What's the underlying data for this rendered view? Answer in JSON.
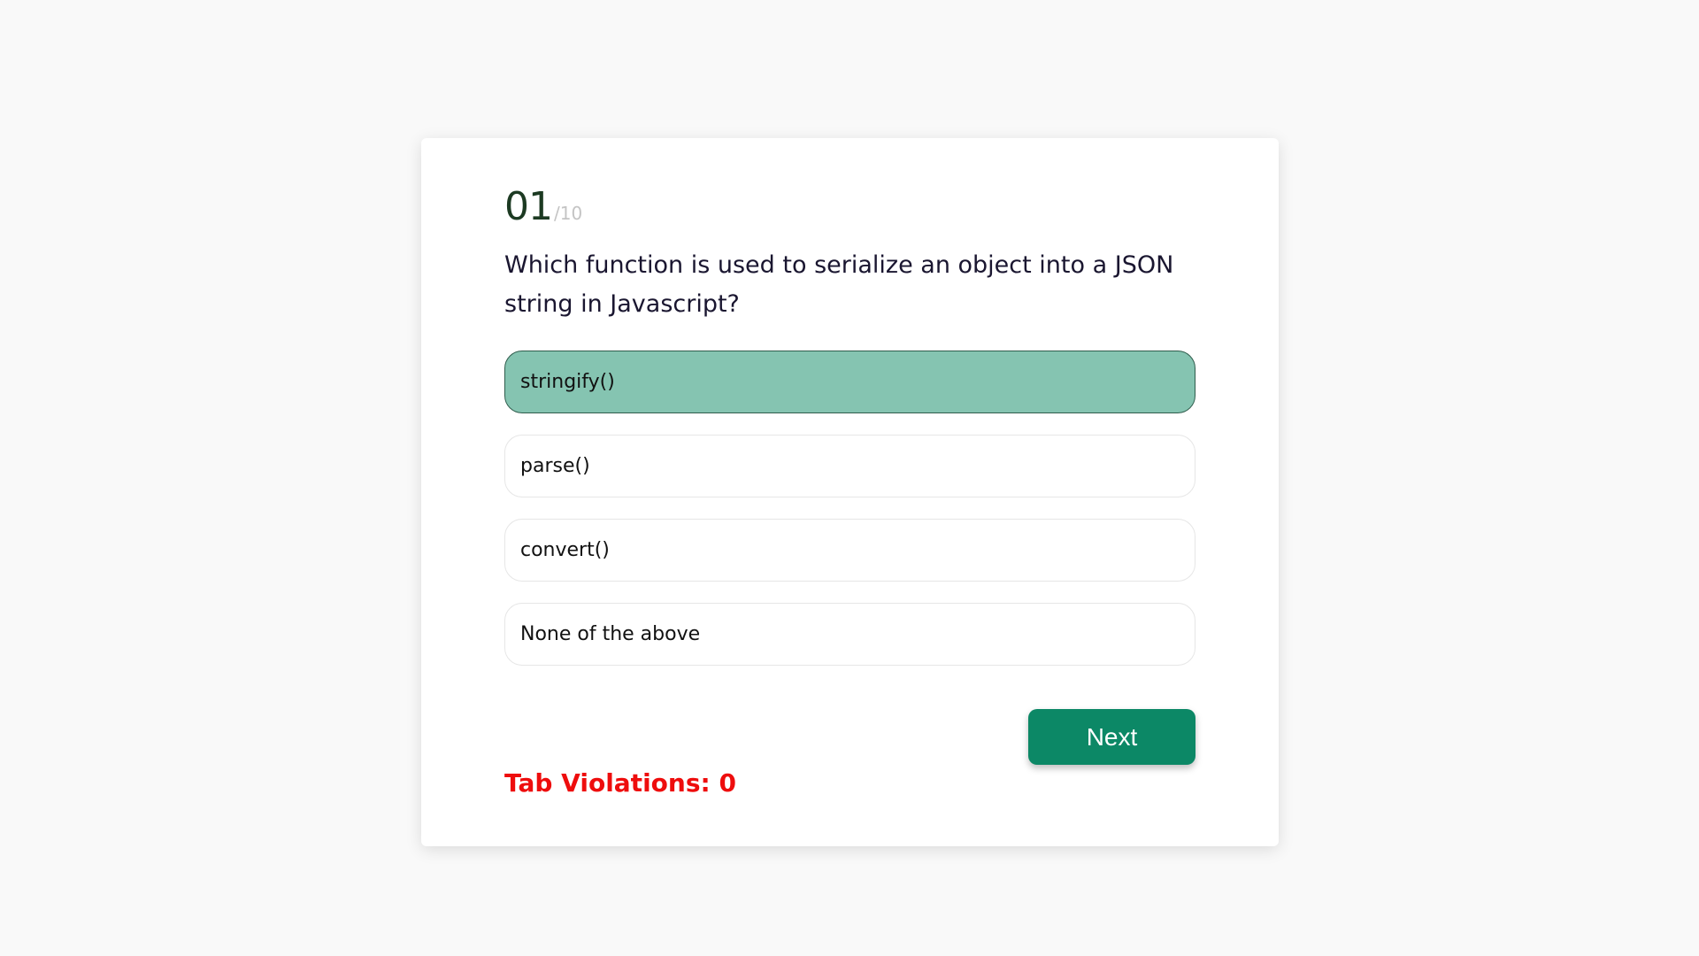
{
  "quiz": {
    "current_question": "01",
    "total_questions": "/10",
    "question_text": "Which function is used to serialize an object into a JSON string in Javascript?",
    "options": [
      {
        "label": "stringify()",
        "selected": true
      },
      {
        "label": "parse()",
        "selected": false
      },
      {
        "label": "convert()",
        "selected": false
      },
      {
        "label": "None of the above",
        "selected": false
      }
    ],
    "next_label": "Next",
    "tab_violations": "Tab Violations: 0"
  },
  "colors": {
    "selected_option": "#85c4b1",
    "next_button": "#0c8866",
    "violations_text": "#ee0d0d"
  }
}
